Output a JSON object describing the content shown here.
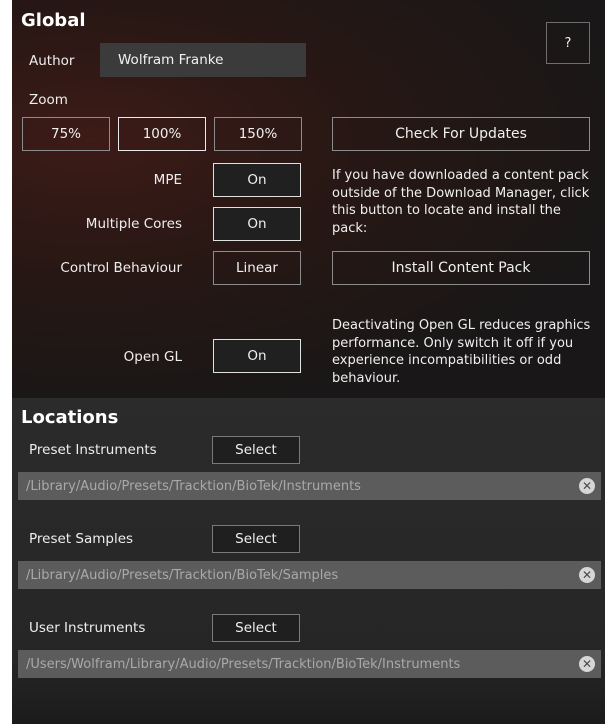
{
  "global": {
    "title": "Global",
    "help_label": "?",
    "author_label": "Author",
    "author_value": "Wolfram Franke",
    "zoom_label": "Zoom",
    "zoom_options": [
      "75%",
      "100%",
      "150%"
    ],
    "zoom_selected": "100%",
    "check_updates_label": "Check For Updates",
    "mpe_label": "MPE",
    "mpe_value": "On",
    "multiple_cores_label": "Multiple Cores",
    "multiple_cores_value": "On",
    "control_behaviour_label": "Control Behaviour",
    "control_behaviour_value": "Linear",
    "content_pack_note": "If you have downloaded a content pack outside of the Download Manager, click this button to locate and install the pack:",
    "install_content_pack_label": "Install Content Pack",
    "open_gl_label": "Open GL",
    "open_gl_value": "On",
    "open_gl_note": "Deactivating Open GL reduces graphics performance. Only switch it off if you experience incompatibilities or odd behaviour."
  },
  "locations": {
    "title": "Locations",
    "items": [
      {
        "label": "Preset Instruments",
        "select_label": "Select",
        "path": "/Library/Audio/Presets/Tracktion/BioTek/Instruments"
      },
      {
        "label": "Preset Samples",
        "select_label": "Select",
        "path": "/Library/Audio/Presets/Tracktion/BioTek/Samples"
      },
      {
        "label": "User Instruments",
        "select_label": "Select",
        "path": "/Users/Wolfram/Library/Audio/Presets/Tracktion/BioTek/Instruments"
      }
    ]
  },
  "icons": {
    "clear": "clear-circle-x-icon",
    "help": "question-mark"
  },
  "colors": {
    "background": "#1a1a1a",
    "field": "#3b3b3b",
    "path_bar": "#5c5c5c",
    "text": "#f2f2f2"
  }
}
